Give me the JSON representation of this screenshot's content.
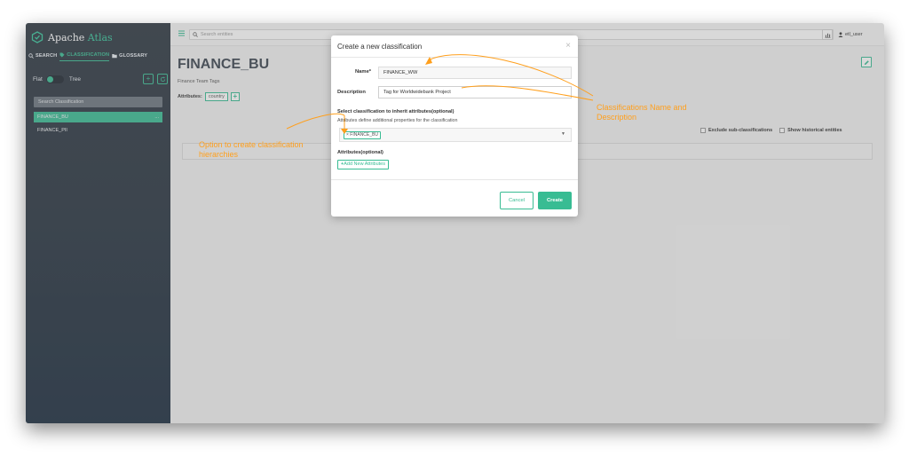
{
  "app": {
    "name_main": "Apache ",
    "name_accent": "Atlas"
  },
  "sidebar": {
    "tabs": [
      {
        "label": "SEARCH",
        "icon": "search-icon"
      },
      {
        "label": "CLASSIFICATION",
        "icon": "tag-icon"
      },
      {
        "label": "GLOSSARY",
        "icon": "folder-icon"
      }
    ],
    "toggle_left": "Flat",
    "toggle_right": "Tree",
    "search_placeholder": "Search Classification",
    "items": [
      {
        "label": "FINANCE_BU",
        "selected": true
      },
      {
        "label": "FINANCE_PII",
        "selected": false
      }
    ],
    "item_menu": "..."
  },
  "header": {
    "search_placeholder": "Search entities",
    "user": "etl_user"
  },
  "main": {
    "title": "FINANCE_BU",
    "subtitle": "Finance Team Tags",
    "attributes_label": "Attributes:",
    "attribute_tag": "country",
    "check_exclude": "Exclude sub-classifications",
    "check_history": "Show historical entities"
  },
  "modal": {
    "title": "Create a new classification",
    "name_label": "Name*",
    "name_value": "FINANCE_WW",
    "description_label": "Description",
    "description_value": "Tag for Worldwidebank Project",
    "inherit_label": "Select classification to inherit attributes(optional)",
    "inherit_sub": "Attributes define additional properties for the classification",
    "inherit_chip": "× FINANCE_BU",
    "attributes_label": "Attributes(optional)",
    "add_attributes_button": "Add New Attributes",
    "cancel_button": "Cancel",
    "create_button": "Create"
  },
  "annotations": {
    "hierarchy_line1": "Option to create classification",
    "hierarchy_line2": "hierarchies",
    "name_desc_line1": "Classifications Name and",
    "name_desc_line2": "Description"
  },
  "colors": {
    "accent": "#38bc93",
    "annotation": "#ff9f1c"
  }
}
